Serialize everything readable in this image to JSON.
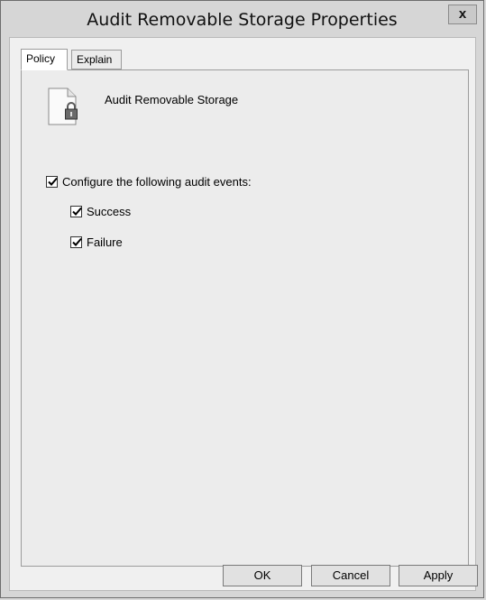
{
  "window": {
    "title": "Audit Removable Storage Properties",
    "close_glyph": "x"
  },
  "tabs": [
    {
      "label": "Policy",
      "active": true
    },
    {
      "label": "Explain",
      "active": false
    }
  ],
  "policy": {
    "icon": "document-lock-icon",
    "name": "Audit Removable Storage"
  },
  "config": {
    "label": "Configure the following audit events:",
    "checked": true,
    "success": {
      "label": "Success",
      "checked": true
    },
    "failure": {
      "label": "Failure",
      "checked": true
    }
  },
  "buttons": {
    "ok": "OK",
    "cancel": "Cancel",
    "apply": "Apply"
  }
}
